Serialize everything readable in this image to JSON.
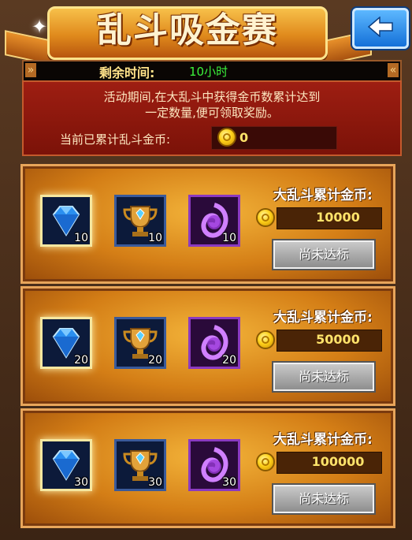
{
  "header": {
    "title": "乱斗吸金赛",
    "back_icon": "back-arrow-icon"
  },
  "timer": {
    "label": "剩余时间:",
    "value": "10小时"
  },
  "info": {
    "desc_line1": "活动期间,在大乱斗中获得金币数累计达到",
    "desc_line2": "一定数量,便可领取奖励。",
    "current_label": "当前已累计乱斗金币:",
    "current_value": "0"
  },
  "tiers": [
    {
      "rewards": [
        {
          "icon": "diamond-icon",
          "count": "10"
        },
        {
          "icon": "trophy-icon",
          "count": "10"
        },
        {
          "icon": "purple-orb-icon",
          "count": "10"
        }
      ],
      "req_label": "大乱斗累计金币:",
      "req_value": "10000",
      "status": "尚未达标"
    },
    {
      "rewards": [
        {
          "icon": "diamond-icon",
          "count": "20"
        },
        {
          "icon": "trophy-icon",
          "count": "20"
        },
        {
          "icon": "purple-orb-icon",
          "count": "20"
        }
      ],
      "req_label": "大乱斗累计金币:",
      "req_value": "50000",
      "status": "尚未达标"
    },
    {
      "rewards": [
        {
          "icon": "diamond-icon",
          "count": "30"
        },
        {
          "icon": "trophy-icon",
          "count": "30"
        },
        {
          "icon": "purple-orb-icon",
          "count": "30"
        }
      ],
      "req_label": "大乱斗累计金币:",
      "req_value": "100000",
      "status": "尚未达标"
    }
  ],
  "colors": {
    "accent_gold": "#ffe36a",
    "timer_green": "#3bf23b",
    "panel_orange": "#d47e16",
    "back_blue": "#1470d8"
  }
}
